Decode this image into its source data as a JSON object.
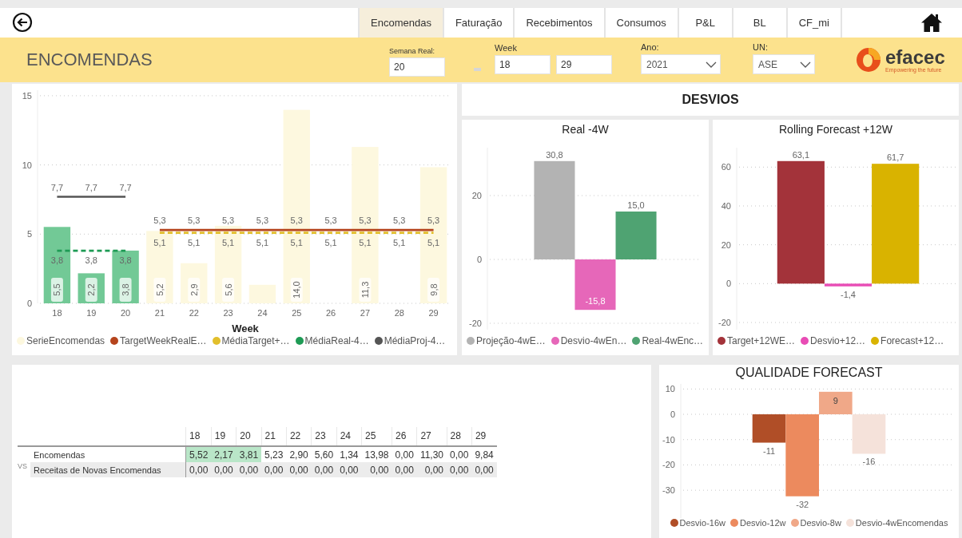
{
  "nav": {
    "tabs": [
      {
        "label": "Encomendas",
        "selected": true
      },
      {
        "label": "Faturação",
        "selected": false
      },
      {
        "label": "Recebimentos",
        "selected": false
      },
      {
        "label": "Consumos",
        "selected": false
      },
      {
        "label": "P&L",
        "selected": false
      },
      {
        "label": "BL",
        "selected": false
      },
      {
        "label": "CF_mi",
        "selected": false
      }
    ]
  },
  "header": {
    "title": "ENCOMENDAS",
    "filters": [
      {
        "kind": "text",
        "label": "Semana Real:",
        "values": [
          "20"
        ]
      },
      {
        "kind": "range",
        "label": "Week",
        "values": [
          "18",
          "29"
        ]
      },
      {
        "kind": "dropdown",
        "label": "Ano:",
        "values": [
          "2021"
        ]
      },
      {
        "kind": "dropdown",
        "label": "UN:",
        "values": [
          "ASE"
        ]
      }
    ],
    "logo": {
      "name": "efacec",
      "tagline": "Empowering the future"
    }
  },
  "orders_chart": {
    "chart_data": {
      "type": "bar",
      "xlabel": "Week",
      "grid": true,
      "stacked": true,
      "ylim": [
        0,
        15.4
      ],
      "categories": [
        "18",
        "19",
        "20",
        "21",
        "22",
        "23",
        "24",
        "25",
        "26",
        "27",
        "28",
        "29"
      ],
      "yticks": [
        0,
        5,
        10,
        15
      ],
      "series": [
        {
          "name": "SerieEncomendas",
          "type": "bar",
          "color": "#fdf8df",
          "values": [
            null,
            null,
            null,
            5.23,
            2.9,
            5.6,
            1.34,
            13.98,
            0,
            11.3,
            0,
            9.84
          ],
          "value_labels": [
            null,
            null,
            null,
            "5,2",
            "2,9",
            "5,6",
            null,
            "14,0",
            null,
            "11,3",
            null,
            "9,8"
          ]
        },
        {
          "type": "bar",
          "color": "#72c996",
          "values": [
            5.52,
            2.17,
            3.81,
            null,
            null,
            null,
            null,
            null,
            null,
            null,
            null,
            null
          ],
          "value_labels": [
            "5,5",
            "2,2",
            "3,8",
            null,
            null,
            null,
            null,
            null,
            null,
            null,
            null,
            null
          ]
        },
        {
          "name": "TargetWeekRealE…",
          "type": "line",
          "color": "#b5441d",
          "values": [
            null,
            null,
            null,
            5.3,
            5.3,
            5.3,
            5.3,
            5.3,
            5.3,
            5.3,
            5.3,
            5.3
          ],
          "value_labels": [
            null,
            null,
            null,
            "5,3",
            "5,3",
            "5,3",
            "5,3",
            "5,3",
            "5,3",
            "5,3",
            "5,3",
            "5,3"
          ]
        },
        {
          "name": "MédiaTarget+…",
          "type": "line",
          "line_style": "dashed",
          "color": "#e2bf2c",
          "values": [
            null,
            null,
            null,
            5.1,
            5.1,
            5.1,
            5.1,
            5.1,
            5.1,
            5.1,
            5.1,
            5.1
          ],
          "value_labels": [
            null,
            null,
            null,
            "5,1",
            "5,1",
            "5,1",
            "5,1",
            "5,1",
            "5,1",
            "5,1",
            "5,1",
            "5,1"
          ]
        },
        {
          "name": "MédiaReal-4…",
          "type": "line",
          "line_style": "dashed",
          "color": "#1e9b55",
          "values": [
            3.8,
            3.8,
            3.8,
            null,
            null,
            null,
            null,
            null,
            null,
            null,
            null,
            null
          ],
          "value_labels": [
            "3,8",
            "3,8",
            "3,8",
            null,
            null,
            null,
            null,
            null,
            null,
            null,
            null,
            null
          ]
        },
        {
          "name": "MédiaProj-4…",
          "type": "line",
          "color": "#555555",
          "values": [
            7.7,
            7.7,
            7.7,
            null,
            null,
            null,
            null,
            null,
            null,
            null,
            null,
            null
          ],
          "value_labels": [
            "7,7",
            "7,7",
            "7,7",
            null,
            null,
            null,
            null,
            null,
            null,
            null,
            null,
            null
          ]
        }
      ]
    }
  },
  "desvios": {
    "title": "DESVIOS",
    "charts": [
      {
        "title": "Real -4W",
        "chart_data": {
          "type": "bar",
          "grid": true,
          "ylim": [
            -22,
            35
          ],
          "yticks": [
            -20,
            0,
            20
          ],
          "series": [
            {
              "name": "Projeção-4wE…",
              "type": "bar",
              "color": "#b3b3b3",
              "values": [
                30.8
              ],
              "value_labels": [
                "30,8"
              ]
            },
            {
              "name": "Desvio-4wEn…",
              "type": "bar",
              "color": "#e667b9",
              "values": [
                -15.8
              ],
              "value_labels": [
                "-15,8"
              ]
            },
            {
              "name": "Real-4wEnc…",
              "type": "bar",
              "color": "#4fa372",
              "values": [
                15.0
              ],
              "value_labels": [
                "15,0"
              ]
            }
          ]
        }
      },
      {
        "title": "Rolling Forecast +12W",
        "chart_data": {
          "type": "bar",
          "grid": true,
          "ylim": [
            -23.7,
            70
          ],
          "yticks": [
            -20,
            0,
            20,
            40,
            60
          ],
          "series": [
            {
              "name": "Target+12WE…",
              "type": "bar",
              "color": "#a3333a",
              "values": [
                63.1
              ],
              "value_labels": [
                "63,1"
              ]
            },
            {
              "name": "Desvio+12…",
              "type": "bar",
              "color": "#e84cb5",
              "values": [
                -1.4
              ],
              "value_labels": [
                "-1,4"
              ]
            },
            {
              "name": "Forecast+12…",
              "type": "bar",
              "color": "#d9b300",
              "values": [
                61.7
              ],
              "value_labels": [
                "61,7"
              ]
            }
          ]
        }
      }
    ]
  },
  "table": {
    "columns": [
      {
        "label": "18",
        "highlighted": true
      },
      {
        "label": "19",
        "highlighted": true
      },
      {
        "label": "20",
        "highlighted": true
      },
      {
        "label": "21",
        "highlighted": false
      },
      {
        "label": "22",
        "highlighted": false
      },
      {
        "label": "23",
        "highlighted": false
      },
      {
        "label": "24",
        "highlighted": false
      },
      {
        "label": "25",
        "highlighted": false
      },
      {
        "label": "26",
        "highlighted": false
      },
      {
        "label": "27",
        "highlighted": false
      },
      {
        "label": "28",
        "highlighted": false
      },
      {
        "label": "29",
        "highlighted": false
      }
    ],
    "rows": [
      {
        "label": "Encomendas",
        "cells": [
          "5,52",
          "2,17",
          "3,81",
          "5,23",
          "2,90",
          "5,60",
          "1,34",
          "13,98",
          "0,00",
          "11,30",
          "0,00",
          "9,84"
        ]
      },
      {
        "prefix": "VS",
        "label": "Receitas de Novas Encomendas",
        "cells": [
          "0,00",
          "0,00",
          "0,00",
          "0,00",
          "0,00",
          "0,00",
          "0,00",
          "0,00",
          "0,00",
          "0,00",
          "0,00",
          "0,00"
        ]
      }
    ]
  },
  "quality": {
    "title": "QUALIDADE FORECAST",
    "chart_data": {
      "type": "bar",
      "grid": true,
      "ylim": [
        -41,
        12
      ],
      "yticks": [
        -30,
        -20,
        -10,
        0,
        10
      ],
      "series": [
        {
          "name": "Desvio-16w",
          "type": "bar",
          "color": "#b04e27",
          "values": [
            -11.2
          ],
          "value_labels": [
            "-11"
          ]
        },
        {
          "name": "Desvio-12w",
          "type": "bar",
          "color": "#ec8a5e",
          "values": [
            -32.4
          ],
          "value_labels": [
            "-32"
          ]
        },
        {
          "name": "Desvio-8w",
          "type": "bar",
          "color": "#f0a888",
          "values": [
            8.9
          ],
          "value_labels": [
            "9"
          ]
        },
        {
          "name": "Desvio-4wEncomendas",
          "type": "bar",
          "color": "#f5e2da",
          "values": [
            -15.6
          ],
          "value_labels": [
            "-16"
          ]
        }
      ]
    }
  }
}
